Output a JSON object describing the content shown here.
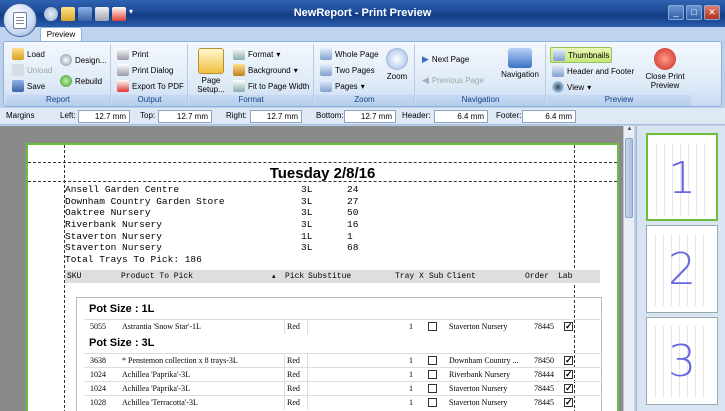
{
  "window": {
    "title": "NewReport - Print Preview",
    "min": "_",
    "max": "□",
    "close": "✕"
  },
  "tabs": [
    {
      "label": "Preview"
    }
  ],
  "ribbon": {
    "report": {
      "label": "Report",
      "load": "Load",
      "unload": "Unload",
      "save": "Save",
      "design": "Design...",
      "rebuild": "Rebuild"
    },
    "output": {
      "label": "Output",
      "print": "Print",
      "print_dialog": "Print Dialog",
      "export_pdf": "Export To PDF"
    },
    "format": {
      "label": "Format",
      "page_setup": "Page Setup...",
      "format": "Format",
      "background": "Background",
      "fit": "Fit to Page Width"
    },
    "zoom": {
      "label": "Zoom",
      "whole_page": "Whole Page",
      "two_pages": "Two Pages",
      "pages": "Pages",
      "zoom": "Zoom"
    },
    "navigation": {
      "label": "Navigation",
      "next_page": "Next Page",
      "previous_page": "Previous Page",
      "navigation": "Navigation"
    },
    "preview": {
      "label": "Preview",
      "thumbnails": "Thumbnails",
      "header_footer": "Header and Footer",
      "view": "View",
      "close": "Close Print Preview"
    }
  },
  "margins": {
    "label": "Margins",
    "left_label": "Left:",
    "left": "12.7 mm",
    "top_label": "Top:",
    "top": "12.7 mm",
    "right_label": "Right:",
    "right": "12.7 mm",
    "bottom_label": "Bottom:",
    "bottom": "12.7 mm",
    "header_label": "Header:",
    "header": "6.4 mm",
    "footer_label": "Footer:",
    "footer": "6.4 mm"
  },
  "report": {
    "title": "Tuesday 2/8/16",
    "summary": [
      {
        "client": "Ansell Garden Centre",
        "size": "3L",
        "trays": "24"
      },
      {
        "client": "Downham Country Garden Store",
        "size": "3L",
        "trays": "27"
      },
      {
        "client": "Oaktree Nursery",
        "size": "3L",
        "trays": "50"
      },
      {
        "client": "Riverbank Nursery",
        "size": "3L",
        "trays": "16"
      },
      {
        "client": "Staverton Nursery",
        "size": "1L",
        "trays": "1"
      },
      {
        "client": "Staverton Nursery",
        "size": "3L",
        "trays": "68"
      }
    ],
    "total_label": "Total Trays To Pick:",
    "total": "186",
    "columns": [
      "SKU",
      "Product To Pick",
      "Pick",
      "Substitue",
      "Tray X",
      "Sub",
      "Client",
      "Order",
      "Lab"
    ],
    "groups": [
      {
        "heading": "Pot Size : 1L",
        "rows": [
          {
            "sku": "5055",
            "product": "Astrantia 'Snow Star'-1L",
            "pick": "Red",
            "tray": "1",
            "sub": false,
            "client": "Staverton Nursery",
            "order": "78445",
            "lab": true
          }
        ]
      },
      {
        "heading": "Pot Size : 3L",
        "rows": [
          {
            "sku": "3638",
            "product": "* Penstemon collection x 8 trays-3L",
            "pick": "Red",
            "tray": "1",
            "sub": false,
            "client": "Downham Country ...",
            "order": "78450",
            "lab": true
          },
          {
            "sku": "1024",
            "product": "Achillea 'Paprika'-3L",
            "pick": "Red",
            "tray": "1",
            "sub": false,
            "client": "Riverbank Nursery",
            "order": "78444",
            "lab": true
          },
          {
            "sku": "1024",
            "product": "Achillea 'Paprika'-3L",
            "pick": "Red",
            "tray": "1",
            "sub": false,
            "client": "Staverton Nursery",
            "order": "78445",
            "lab": true
          },
          {
            "sku": "1028",
            "product": "Achillea 'Terracotta'-3L",
            "pick": "Red",
            "tray": "1",
            "sub": false,
            "client": "Staverton Nursery",
            "order": "78445",
            "lab": true
          }
        ]
      }
    ]
  },
  "thumbnails": [
    {
      "number": "1"
    },
    {
      "number": "2"
    },
    {
      "number": "3"
    }
  ]
}
